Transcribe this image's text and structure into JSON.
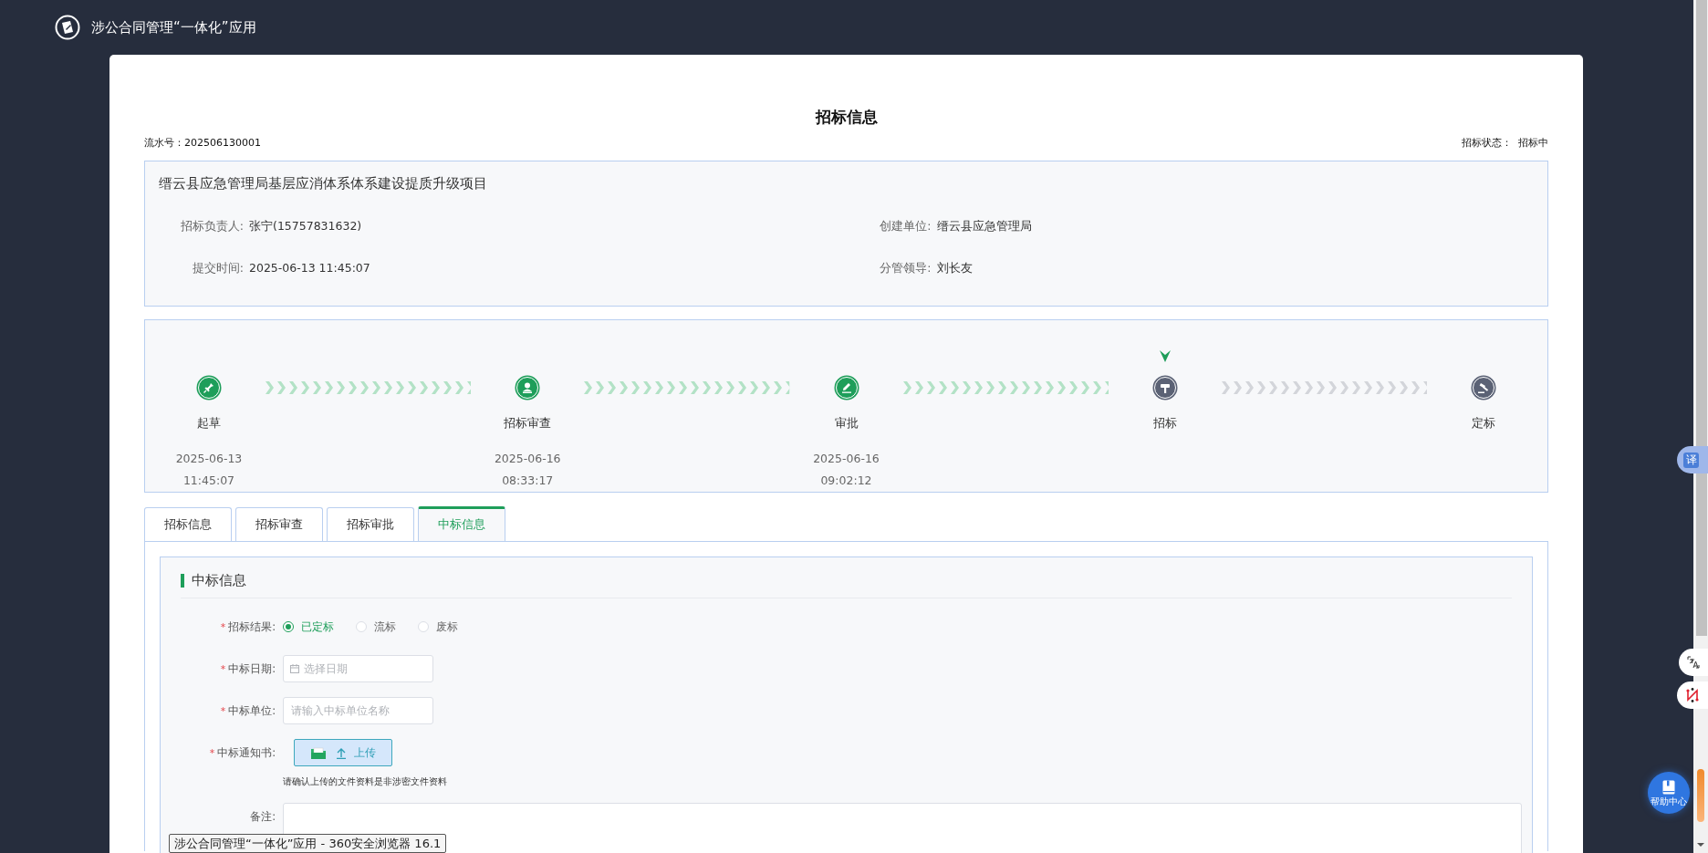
{
  "header": {
    "title": "涉公合同管理“一体化”应用"
  },
  "page": {
    "title": "招标信息",
    "serial": "流水号：202506130001",
    "status": "招标状态：  招标中"
  },
  "project": {
    "name": "缙云县应急管理局基层应消体系体系建设提质升级项目",
    "fields": [
      {
        "label": "招标负责人:",
        "value": "张宁(15757831632)"
      },
      {
        "label": "创建单位:",
        "value": "缙云县应急管理局"
      },
      {
        "label": "提交时间:",
        "value": "2025-06-13 11:45:07"
      },
      {
        "label": "分管领导:",
        "value": "刘长友"
      }
    ]
  },
  "steps": [
    {
      "label": "起草",
      "completed": true,
      "current": false,
      "date": "2025-06-13",
      "time": "11:45:07"
    },
    {
      "label": "招标审查",
      "completed": true,
      "current": false,
      "date": "2025-06-16",
      "time": "08:33:17"
    },
    {
      "label": "审批",
      "completed": true,
      "current": false,
      "date": "2025-06-16",
      "time": "09:02:12"
    },
    {
      "label": "招标",
      "completed": false,
      "current": true
    },
    {
      "label": "定标",
      "completed": false,
      "current": false
    }
  ],
  "tabs": [
    {
      "label": "招标信息",
      "selected": false
    },
    {
      "label": "招标审查",
      "selected": false
    },
    {
      "label": "招标审批",
      "selected": false
    },
    {
      "label": "中标信息",
      "selected": true
    }
  ],
  "form": {
    "section_title": "中标信息",
    "fields": [
      {
        "kind": "radio",
        "required_mark": "*",
        "label": "招标结果:",
        "options": [
          {
            "label": "已定标",
            "selected": true
          },
          {
            "label": "流标",
            "selected": false
          },
          {
            "label": "废标",
            "selected": false
          }
        ]
      },
      {
        "kind": "date",
        "required_mark": "*",
        "label": "中标日期:",
        "placeholder": "选择日期"
      },
      {
        "kind": "text",
        "required_mark": "*",
        "label": "中标单位:",
        "placeholder": "请输入中标单位名称"
      },
      {
        "kind": "upload",
        "required_mark": "*",
        "label": "中标通知书:",
        "button": "上传",
        "hint": "请确认上传的文件资料是非涉密文件资料"
      },
      {
        "kind": "textarea",
        "label": "备注:"
      }
    ]
  },
  "tooltip": {
    "text": "涉公合同管理“一体化”应用 - 360安全浏览器 16.1"
  },
  "side_tools": {
    "translate_tab": "译",
    "help_center": "帮助中心"
  }
}
